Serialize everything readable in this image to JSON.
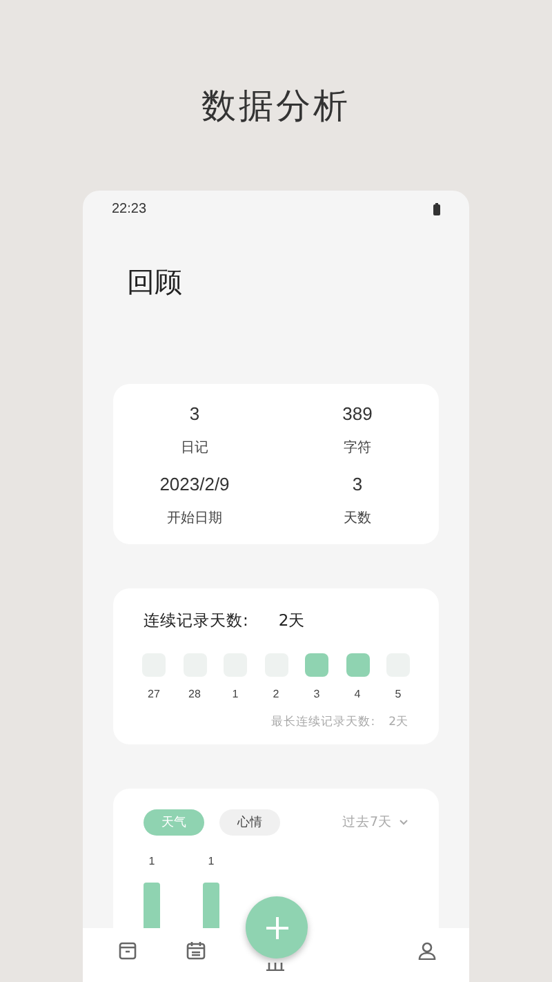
{
  "heading": "数据分析",
  "status_bar": {
    "time": "22:23"
  },
  "title": "回顾",
  "summary": [
    {
      "value": "3",
      "label": "日记"
    },
    {
      "value": "389",
      "label": "字符"
    },
    {
      "value": "2023/2/9",
      "label": "开始日期"
    },
    {
      "value": "3",
      "label": "天数"
    }
  ],
  "streak": {
    "label": "连续记录天数:",
    "value": "2天",
    "days": [
      {
        "label": "27",
        "filled": false
      },
      {
        "label": "28",
        "filled": false
      },
      {
        "label": "1",
        "filled": false
      },
      {
        "label": "2",
        "filled": false
      },
      {
        "label": "3",
        "filled": true
      },
      {
        "label": "4",
        "filled": true
      },
      {
        "label": "5",
        "filled": false
      }
    ],
    "longest_label": "最长连续记录天数:",
    "longest_value": "2天"
  },
  "stats": {
    "tabs": [
      {
        "label": "天气",
        "selected": true
      },
      {
        "label": "心情",
        "selected": false
      }
    ],
    "range": "过去7天",
    "bars": [
      {
        "label": "1"
      },
      {
        "label": "1"
      }
    ]
  }
}
